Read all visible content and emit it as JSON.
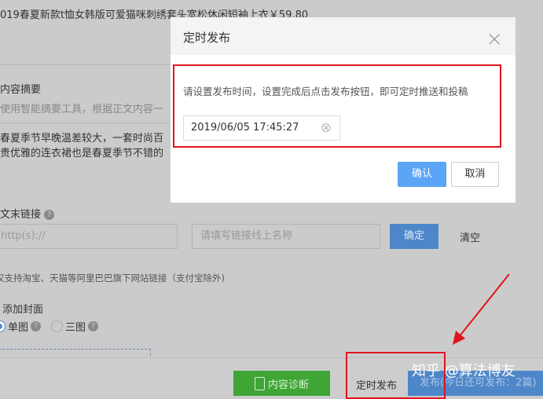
{
  "page": {
    "product_title": "019春夏新款t恤女韩版可爱猫咪刺绣套头宽松休闲短袖上衣￥59.80",
    "summary_label": "内容摘要",
    "summary_hint": "使用智能摘要工具，根据正文内容一",
    "summary_line1": "春夏季节早晚温差较大，一套时尚百",
    "summary_line2": "贵优雅的连衣裙也是春夏季节不错的",
    "end_link_label": "文末链接",
    "url_placeholder": "http(s)://",
    "name_placeholder": "请填写链接线上名称",
    "confirm_label": "确定",
    "clear_label": "清空",
    "link_note": "仅支持淘宝、天猫等阿里巴巴旗下网站链接（支付宝除外)",
    "cover_label": "添加封面",
    "cover_single": "单图",
    "cover_triple": "三图",
    "help": "?"
  },
  "footer": {
    "diagnose_label": "内容诊断",
    "schedule_label": "定时发布",
    "publish_label": "发布(今日还可发布：2篇)"
  },
  "watermark": "知乎 @算法博友",
  "dialog": {
    "title": "定时发布",
    "close": "×",
    "description": "请设置发布时间，设置完成后点击发布按钮，即可定时推送和投稿",
    "datetime_value": "2019/06/05 17:45:27",
    "clear_icon": "⊗",
    "ok_label": "确认",
    "cancel_label": "取消"
  },
  "colors": {
    "accent": "#5aa5f5",
    "green": "#3fa535",
    "annotation": "#e0141e"
  }
}
